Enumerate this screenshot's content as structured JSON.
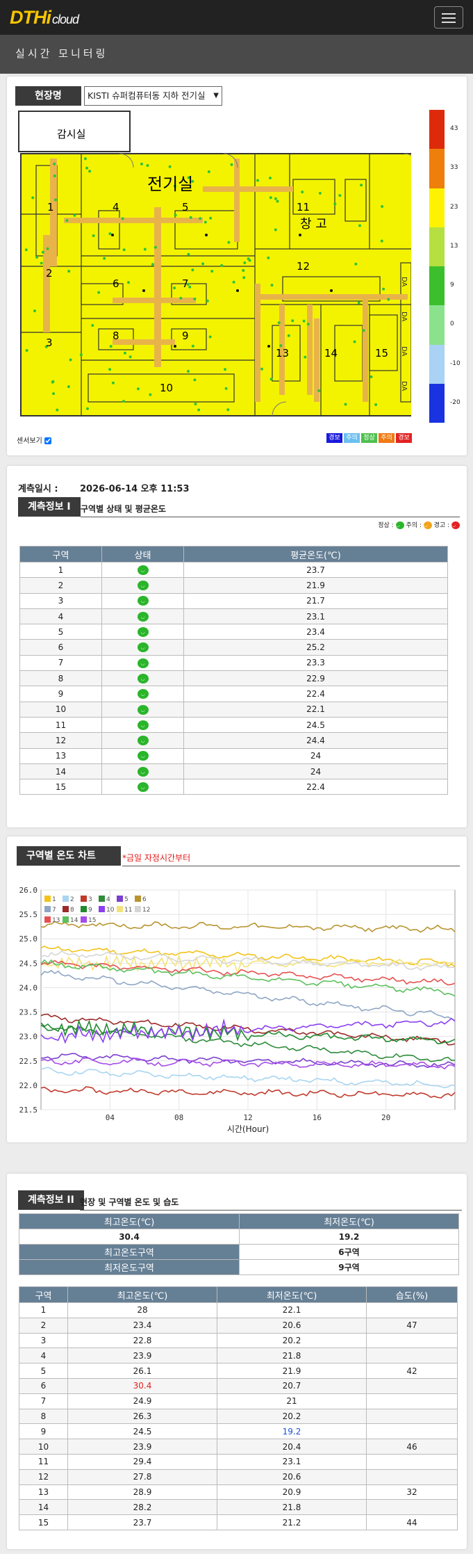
{
  "app": {
    "logo_main": "DTHi",
    "logo_sub": "cloud",
    "page_title": "실시간 모니터링"
  },
  "site": {
    "label": "현장명",
    "selected": "KISTI 슈퍼컴퓨터동 지하 전기실",
    "show_sensors": "센서보기"
  },
  "floorplan": {
    "rooms": {
      "control": "감시실",
      "electric": "전기실",
      "storage": "창 고"
    },
    "zones": [
      "1",
      "2",
      "3",
      "4",
      "5",
      "6",
      "7",
      "8",
      "9",
      "10",
      "11",
      "12",
      "13",
      "14",
      "15"
    ],
    "da_label": "DA"
  },
  "legend": {
    "ticks": [
      "43",
      "33",
      "23",
      "13",
      "9",
      "0",
      "-10",
      "-20"
    ],
    "colors": [
      "#dd2a0a",
      "#ee7f0b",
      "#fff200",
      "#b5e03f",
      "#3bbf2d",
      "#8ae28c",
      "#a9d2f4",
      "#1933e0"
    ]
  },
  "status_buttons": [
    {
      "label": "경보",
      "color": "#1a1adc"
    },
    {
      "label": "주의",
      "color": "#6bbff0"
    },
    {
      "label": "정상",
      "color": "#4fc04f"
    },
    {
      "label": "주의",
      "color": "#f07a14"
    },
    {
      "label": "경보",
      "color": "#e32222"
    }
  ],
  "measure": {
    "time_label": "계측일시 :",
    "time_value": "2026-06-14 오후 11:53"
  },
  "info1": {
    "label": "계측정보 I",
    "subtitle": "구역별 상태 및 평균온도",
    "legend": {
      "normal": "정상 :",
      "caution": "주의 :",
      "warning": "경고 :"
    },
    "headers": [
      "구역",
      "상태",
      "평균온도(℃)"
    ],
    "rows": [
      [
        "1",
        "23.7"
      ],
      [
        "2",
        "21.9"
      ],
      [
        "3",
        "21.7"
      ],
      [
        "4",
        "23.1"
      ],
      [
        "5",
        "23.4"
      ],
      [
        "6",
        "25.2"
      ],
      [
        "7",
        "23.3"
      ],
      [
        "8",
        "22.9"
      ],
      [
        "9",
        "22.4"
      ],
      [
        "10",
        "22.1"
      ],
      [
        "11",
        "24.5"
      ],
      [
        "12",
        "24.4"
      ],
      [
        "13",
        "24"
      ],
      [
        "14",
        "24"
      ],
      [
        "15",
        "22.4"
      ]
    ]
  },
  "chart_section": {
    "label": "구역별 온도 차트",
    "note": "*금일 자정시간부터"
  },
  "chart_data": {
    "type": "line",
    "xlabel": "시간(Hour)",
    "ylabel": "",
    "title": "",
    "xlim": [
      0,
      24
    ],
    "ylim": [
      21.5,
      26.0
    ],
    "xticks": [
      "04",
      "08",
      "12",
      "16",
      "20"
    ],
    "yticks": [
      "26.0",
      "25.5",
      "25.0",
      "24.5",
      "24.0",
      "23.5",
      "23.0",
      "22.5",
      "22.0",
      "21.5"
    ],
    "grid": true,
    "legend_position": "top-left",
    "series": [
      {
        "name": "1",
        "color": "#f2c31a",
        "start": 24.8,
        "end": 24.5,
        "osc": [
          0,
          0
        ]
      },
      {
        "name": "2",
        "color": "#a9d5f0",
        "start": 22.3,
        "end": 22.0,
        "osc": [
          0,
          0
        ]
      },
      {
        "name": "3",
        "color": "#c0392b",
        "start": 21.9,
        "end": 21.8,
        "osc": [
          0,
          0
        ]
      },
      {
        "name": "4",
        "color": "#2e8b3a",
        "start": 23.2,
        "end": 22.5,
        "osc": [
          0,
          0
        ]
      },
      {
        "name": "5",
        "color": "#7b3fd0",
        "start": 22.6,
        "end": 22.4,
        "osc": [
          0,
          0
        ]
      },
      {
        "name": "6",
        "color": "#b8942e",
        "start": 25.3,
        "end": 25.2,
        "osc": [
          0,
          0
        ]
      },
      {
        "name": "7",
        "color": "#8ea6c4",
        "start": 24.3,
        "end": 23.4,
        "osc": [
          0,
          0
        ]
      },
      {
        "name": "8",
        "color": "#9c2a2a",
        "start": 23.4,
        "end": 22.9,
        "osc": [
          0,
          0
        ]
      },
      {
        "name": "9",
        "color": "#1f8a2e",
        "start": 23.2,
        "end": 22.9,
        "osc": [
          1,
          12
        ]
      },
      {
        "name": "10",
        "color": "#8a3ff0",
        "start": 23.0,
        "end": 23.3,
        "osc": [
          1,
          12
        ]
      },
      {
        "name": "11",
        "color": "#f4e27a",
        "start": 24.5,
        "end": 24.5,
        "osc": [
          1,
          12
        ]
      },
      {
        "name": "12",
        "color": "#d6d6d6",
        "start": 24.7,
        "end": 24.4,
        "osc": [
          0,
          0
        ]
      },
      {
        "name": "13",
        "color": "#e65050",
        "start": 24.5,
        "end": 24.1,
        "osc": [
          0,
          0
        ]
      },
      {
        "name": "14",
        "color": "#5cbf5c",
        "start": 24.5,
        "end": 23.9,
        "osc": [
          0,
          0
        ]
      },
      {
        "name": "15",
        "color": "#a64be8",
        "start": 22.5,
        "end": 22.4,
        "osc": [
          0,
          0
        ]
      }
    ]
  },
  "info2": {
    "label": "계측정보 II",
    "subtitle": "현장 및 구역별 온도 및 습도",
    "summary_headers": [
      "최고온도(℃)",
      "최저온도(℃)"
    ],
    "max_temp": "30.4",
    "min_temp": "19.2",
    "max_zone_label": "최고온도구역",
    "max_zone": "6구역",
    "min_zone_label": "최저온도구역",
    "min_zone": "9구역",
    "headers": [
      "구역",
      "최고온도(℃)",
      "최저온도(℃)",
      "습도(%)"
    ],
    "rows": [
      [
        "1",
        "28",
        "22.1",
        ""
      ],
      [
        "2",
        "23.4",
        "20.6",
        "47"
      ],
      [
        "3",
        "22.8",
        "20.2",
        ""
      ],
      [
        "4",
        "23.9",
        "21.8",
        ""
      ],
      [
        "5",
        "26.1",
        "21.9",
        "42"
      ],
      [
        "6",
        "30.4",
        "20.7",
        ""
      ],
      [
        "7",
        "24.9",
        "21",
        ""
      ],
      [
        "8",
        "26.3",
        "20.2",
        ""
      ],
      [
        "9",
        "24.5",
        "19.2",
        ""
      ],
      [
        "10",
        "23.9",
        "20.4",
        "46"
      ],
      [
        "11",
        "29.4",
        "23.1",
        ""
      ],
      [
        "12",
        "27.8",
        "20.6",
        ""
      ],
      [
        "13",
        "28.9",
        "20.9",
        "32"
      ],
      [
        "14",
        "28.2",
        "21.8",
        ""
      ],
      [
        "15",
        "23.7",
        "21.2",
        "44"
      ]
    ],
    "max_color": "#e32222",
    "min_color": "#1a4fdc"
  }
}
